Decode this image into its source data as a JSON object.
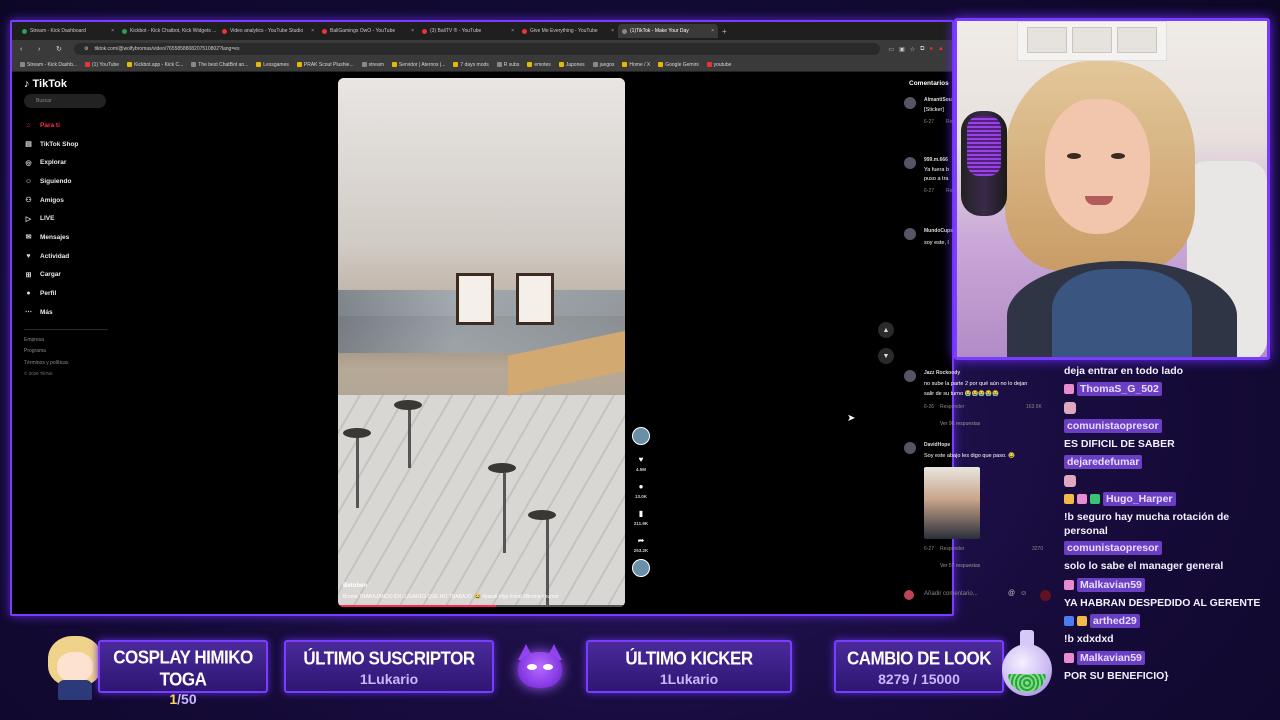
{
  "browser": {
    "tabs": [
      {
        "label": "Stream - Kick Dashboard",
        "icon": "kick-icon"
      },
      {
        "label": "Kickbot - Kick Chatbot, Kick Widgets ...",
        "icon": "kickbot-icon"
      },
      {
        "label": "Video analytics - YouTube Studio",
        "icon": "youtube-icon"
      },
      {
        "label": "BaliGamings OwO - YouTube",
        "icon": "youtube-icon"
      },
      {
        "label": "(3) BaliTV ® - YouTube",
        "icon": "youtube-icon"
      },
      {
        "label": "Give Me Everything - YouTube",
        "icon": "youtube-icon"
      },
      {
        "label": "(1)TikTok - Make Your Day",
        "icon": "tiktok-icon"
      }
    ],
    "url": "tiktok.com/@wolfybromas/video/7655858808207510802?lang=es",
    "bookmarks": [
      "Stream - Kick Dashb...",
      "(1) YouTube",
      "Kickbot.app - Kick C...",
      "The best ChatBot an...",
      "Lessgames",
      "PRAK Scout Plushie...",
      "stream",
      "Servidor | Aternos |...",
      "7 days mods",
      "R subs",
      "emotes",
      "Japones",
      "juegos",
      "Home / X",
      "Google Gemini",
      "youtube"
    ]
  },
  "tiktok": {
    "logo": "TikTok",
    "search_placeholder": "Buscar",
    "nav": [
      {
        "label": "Para ti",
        "icon": "home-icon",
        "active": true
      },
      {
        "label": "TikTok Shop",
        "icon": "shop-icon"
      },
      {
        "label": "Explorar",
        "icon": "compass-icon"
      },
      {
        "label": "Siguiendo",
        "icon": "following-icon"
      },
      {
        "label": "Amigos",
        "icon": "friends-icon"
      },
      {
        "label": "LIVE",
        "icon": "live-icon"
      },
      {
        "label": "Mensajes",
        "icon": "messages-icon"
      },
      {
        "label": "Actividad",
        "icon": "activity-icon"
      },
      {
        "label": "Cargar",
        "icon": "upload-icon"
      },
      {
        "label": "Perfil",
        "icon": "profile-icon"
      },
      {
        "label": "Más",
        "icon": "more-icon"
      }
    ],
    "footer": [
      "Empresa",
      "Programa",
      "Términos y políticas",
      "© 2026 TikTok"
    ],
    "video": {
      "author": "Betoben",
      "caption": "Broma TRABAJANDO EN LUGARES QUE NO TRABAJO. 😂 #parati #fyp #viral #Broma #humor",
      "progress": 0.55
    },
    "actions": [
      {
        "icon": "heart-icon",
        "count": "4.5M"
      },
      {
        "icon": "comment-icon",
        "count": "13.0K"
      },
      {
        "icon": "bookmark-icon",
        "count": "211.9K"
      },
      {
        "icon": "share-icon",
        "count": "253.2K"
      }
    ],
    "comments_title": "Comentarios",
    "comments": [
      {
        "user": "AlmantiSou",
        "text": "[Sticker] ",
        "meta": "6-27",
        "reply": "Resp"
      },
      {
        "user": "999.m.666",
        "text": "Ya fuera b",
        "text2": "puso a tra",
        "meta": "6-27",
        "reply": "Resp"
      },
      {
        "user": "MundoCups",
        "text": "soy este, l"
      },
      {
        "user": "Jazz Rockoody",
        "text": "no sube la parte 2 por qué aún no lo dejan",
        "text2": "salir de su turno 😭😭😭😭😭",
        "meta": "6-26",
        "reply": "Responder",
        "likes": "163.6K",
        "more": "Ver 96 respuestas"
      },
      {
        "user": "DavidHope",
        "text": "Soy este abajo les digo que paso. 😂",
        "meta": "6-27",
        "reply": "Responder",
        "likes": "3270",
        "more": "Ver 57 respuestas"
      }
    ],
    "add_comment_placeholder": "Añadir comentario..."
  },
  "chat": [
    {
      "msg": "deja entrar en todo lado"
    },
    {
      "user": "ThomaS_G_502",
      "badges": [
        "b-pink"
      ]
    },
    {
      "emote": true
    },
    {
      "user": "comunistaopresor"
    },
    {
      "msg": "ES DIFICIL DE SABER"
    },
    {
      "user": "dejaredefumar"
    },
    {
      "emote": true
    },
    {
      "user": "Hugo_Harper",
      "badges": [
        "b-gold",
        "b-pink",
        "b-green"
      ]
    },
    {
      "msg": "!b seguro hay mucha rotación de personal",
      "tall": true
    },
    {
      "user": "comunistaopresor"
    },
    {
      "msg": "solo lo sabe el manager general"
    },
    {
      "user": "Malkavian59",
      "badges": [
        "b-pink"
      ]
    },
    {
      "msg": "YA HABRAN DESPEDIDO AL GERENTE"
    },
    {
      "user": "arthed29",
      "badges": [
        "b-blue",
        "b-gold"
      ]
    },
    {
      "msg": "!b xdxdxd"
    },
    {
      "user": "Malkavian59",
      "badges": [
        "b-pink"
      ]
    },
    {
      "msg": "POR SU BENEFICIO}"
    }
  ],
  "widgets": {
    "cosplay": {
      "title": "COSPLAY HIMIKO TOGA",
      "current": "1",
      "total": "/50"
    },
    "suscriptor": {
      "title": "ÚLTIMO SUSCRIPTOR",
      "value": "1Lukario"
    },
    "kicker": {
      "title": "ÚLTIMO KICKER",
      "value": "1Lukario"
    },
    "look": {
      "title": "CAMBIO DE LOOK",
      "value": "8279 / 15000"
    }
  },
  "colors": {
    "accent": "#7a3cff",
    "tiktok_red": "#fe2c55",
    "panel": "#2e1672"
  }
}
